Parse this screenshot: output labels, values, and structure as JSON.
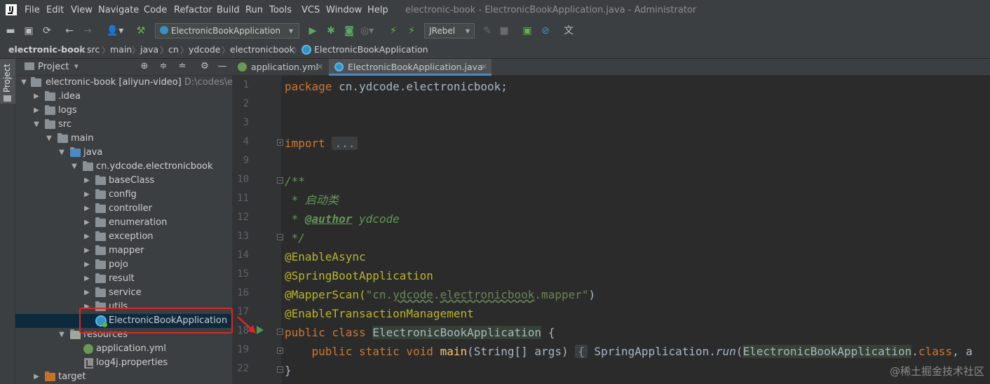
{
  "menubar": {
    "logo": "IJ",
    "items": [
      "File",
      "Edit",
      "View",
      "Navigate",
      "Code",
      "Refactor",
      "Build",
      "Run",
      "Tools",
      "VCS",
      "Window",
      "Help"
    ],
    "window_title": "electronic-book - ElectronicBookApplication.java - Administrator"
  },
  "toolbar": {
    "run_config": "ElectronicBookApplication",
    "jrebel": "JRebel"
  },
  "breadcrumbs": [
    "electronic-book",
    "src",
    "main",
    "java",
    "cn",
    "ydcode",
    "electronicbook",
    "ElectronicBookApplication"
  ],
  "side_tool": {
    "project_label": "Project"
  },
  "project_panel": {
    "title": "Project",
    "root_name": "electronic-book [aliyun-video]",
    "root_path": "D:\\codes\\elec",
    "tree": [
      {
        "label": "electronic-book [aliyun-video]"
      },
      {
        "label": ".idea"
      },
      {
        "label": "logs"
      },
      {
        "label": "src"
      },
      {
        "label": "main"
      },
      {
        "label": "java"
      },
      {
        "label": "cn.ydcode.electronicbook"
      },
      {
        "label": "baseClass"
      },
      {
        "label": "config"
      },
      {
        "label": "controller"
      },
      {
        "label": "enumeration"
      },
      {
        "label": "exception"
      },
      {
        "label": "mapper"
      },
      {
        "label": "pojo"
      },
      {
        "label": "result"
      },
      {
        "label": "service"
      },
      {
        "label": "utils"
      },
      {
        "label": "ElectronicBookApplication"
      },
      {
        "label": "resources"
      },
      {
        "label": "application.yml"
      },
      {
        "label": "log4j.properties"
      },
      {
        "label": "target"
      }
    ]
  },
  "editor": {
    "tabs": [
      {
        "label": "application.yml"
      },
      {
        "label": "ElectronicBookApplication.java"
      }
    ],
    "line_numbers": [
      "1",
      "2",
      "3",
      "4",
      "9",
      "10",
      "11",
      "12",
      "13",
      "14",
      "15",
      "16",
      "17",
      "18",
      "19",
      "22"
    ],
    "code": {
      "l1_kw": "package",
      "l1_rest": " cn.ydcode.electronicbook;",
      "l4_kw": "import",
      "l4_fold": "...",
      "l10": "/**",
      "l11": " * 启动类",
      "l12_star": " * ",
      "l12_tag": "@author",
      "l12_val": " ydcode",
      "l13": " */",
      "l14": "@EnableAsync",
      "l15": "@SpringBootApplication",
      "l16_ann": "@MapperScan(",
      "l16_str_a": "\"cn.",
      "l16_str_b": "ydcode",
      "l16_str_c": ".",
      "l16_str_d": "electronicbook",
      "l16_str_e": ".mapper\"",
      "l16_end": ")",
      "l17": "@EnableTransactionManagement",
      "l18_kw": "public class",
      "l18_cls": "ElectronicBookApplication",
      "l18_end": " {",
      "l19_kw": "    public static void",
      "l19_meth": "main",
      "l19_args": "(String[] args) ",
      "l19_fold": "{",
      "l19_call": " SpringApplication.",
      "l19_run": "run",
      "l19_paren": "(",
      "l19_cls": "ElectronicBookApplication",
      "l19_dot": ".",
      "l19_classkw": "class",
      "l19_tail": ", a",
      "l22": "}"
    }
  },
  "watermark": "@稀土掘金技术社区"
}
